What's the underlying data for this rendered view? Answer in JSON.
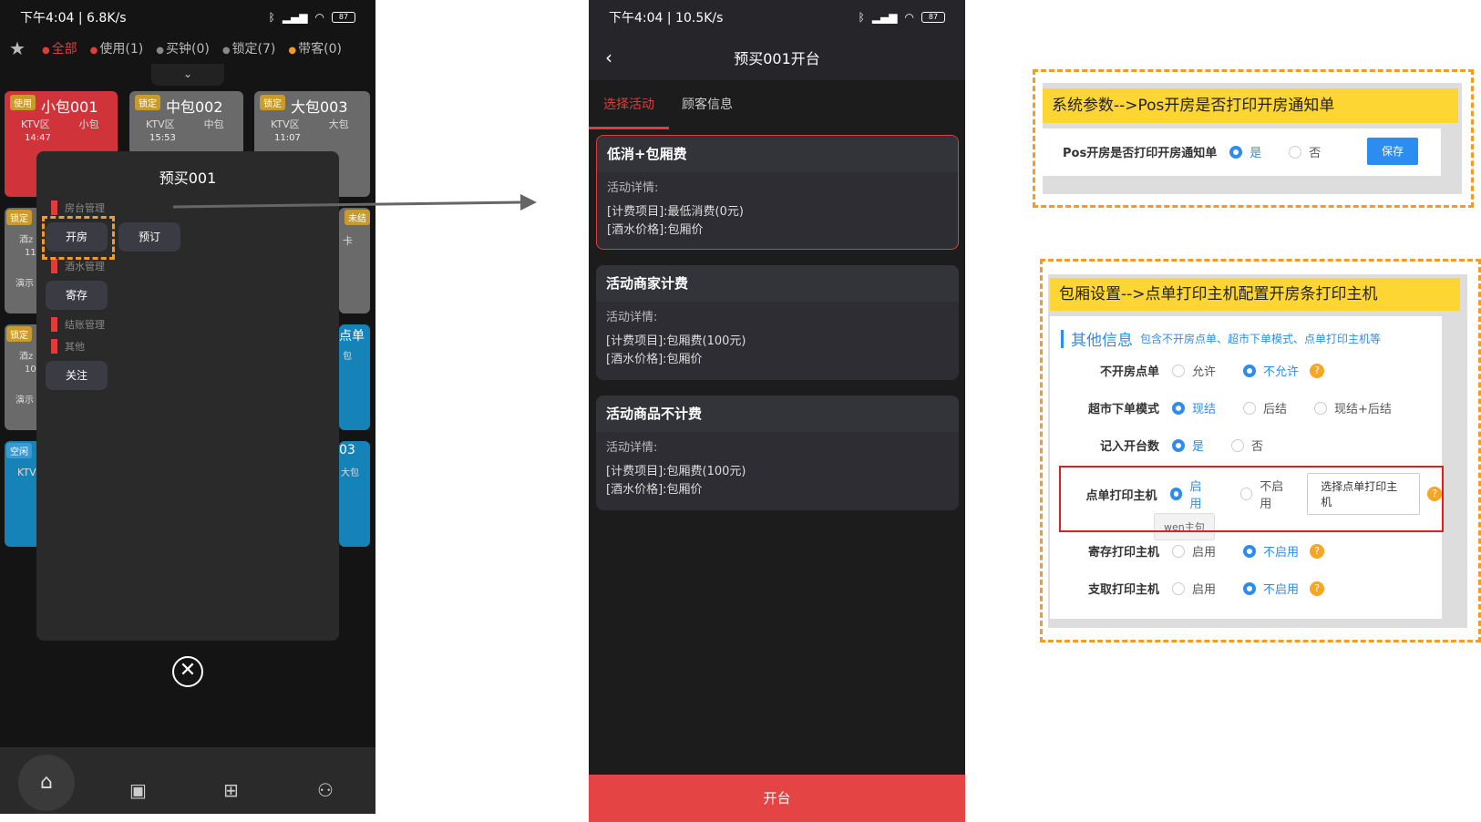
{
  "phone1": {
    "status": {
      "time": "下午4:04 | 6.8K/s",
      "battery": "87"
    },
    "tabs": {
      "all": "全部",
      "use": "使用(1)",
      "buy": "买钟(0)",
      "lock": "锁定(7)",
      "guest": "带客(0)"
    },
    "rooms": [
      {
        "badge": "使用",
        "name": "小包001",
        "area": "KTV区",
        "type": "小包",
        "time": "14:47",
        "color": "#d0333a"
      },
      {
        "badge": "锁定",
        "name": "中包002",
        "area": "KTV区",
        "type": "中包",
        "time": "15:53",
        "color": "#6a6a6a"
      },
      {
        "badge": "锁定",
        "name": "大包003",
        "area": "KTV区",
        "type": "大包",
        "time": "11:07",
        "color": "#6a6a6a"
      }
    ],
    "side_fragments": {
      "r2_badge": "锁定",
      "r2_a": "酒z",
      "r2_b": "11:",
      "r2_c": "演示",
      "r2_right_badge": "未结",
      "r2_right": "卡",
      "r3_badge": "锁定",
      "r3_a": "酒z",
      "r3_b": "10:",
      "r3_c": "演示",
      "r3_right": "点单",
      "r3_right2": "包",
      "r4_badge": "空闲",
      "r4_a": "KTV",
      "r4_right": "03",
      "r4_right2": "大包"
    },
    "modal": {
      "title": "预买001",
      "section_room": "房台管理",
      "open": "开房",
      "reserve": "预订",
      "section_drink": "酒水管理",
      "deposit": "寄存",
      "section_bill": "结账管理",
      "section_other": "其他",
      "follow": "关注",
      "close_glyph": "✕"
    }
  },
  "phone2": {
    "status": {
      "time": "下午4:04 | 10.5K/s",
      "battery": "87"
    },
    "title": "预买001开台",
    "tabs": [
      "选择活动",
      "顾客信息"
    ],
    "detail_label": "活动详情:",
    "cards": [
      {
        "title": "低消+包厢费",
        "item": "[计费项目]:最低消费(0元)",
        "price": "[酒水价格]:包厢价"
      },
      {
        "title": "活动商家计费",
        "item": "[计费项目]:包厢费(100元)",
        "price": "[酒水价格]:包厢价"
      },
      {
        "title": "活动商品不计费",
        "item": "[计费项目]:包厢费(100元)",
        "price": "[酒水价格]:包厢价"
      }
    ],
    "open_button": "开台"
  },
  "panel1": {
    "title": "系统参数-->Pos开房是否打印开房通知单",
    "label": "Pos开房是否打印开房通知单",
    "yes": "是",
    "no": "否",
    "save": "保存"
  },
  "panel2": {
    "title": "包厢设置-->点单打印主机配置开房条打印主机",
    "section": "其他信息",
    "section_hint": "包含不开房点单、超市下单模式、点单打印主机等",
    "rows": {
      "r1": {
        "label": "不开房点单",
        "a": "允许",
        "b": "不允许"
      },
      "r2": {
        "label": "超市下单模式",
        "a": "现结",
        "b": "后结",
        "c": "现结+后结"
      },
      "r3": {
        "label": "记入开台数",
        "a": "是",
        "b": "否"
      },
      "r4": {
        "label": "点单打印主机",
        "a": "启用",
        "b": "不启用",
        "btn": "选择点单打印主机",
        "tag": "wen主句"
      },
      "r5": {
        "label": "寄存打印主机",
        "a": "启用",
        "b": "不启用"
      },
      "r6": {
        "label": "支取打印主机",
        "a": "启用",
        "b": "不启用"
      }
    },
    "help": "?"
  },
  "colors": {
    "accent": "#e23b3b",
    "highlight": "#f59a23",
    "title_bg": "#fed633",
    "radio": "#2d8cf0"
  }
}
